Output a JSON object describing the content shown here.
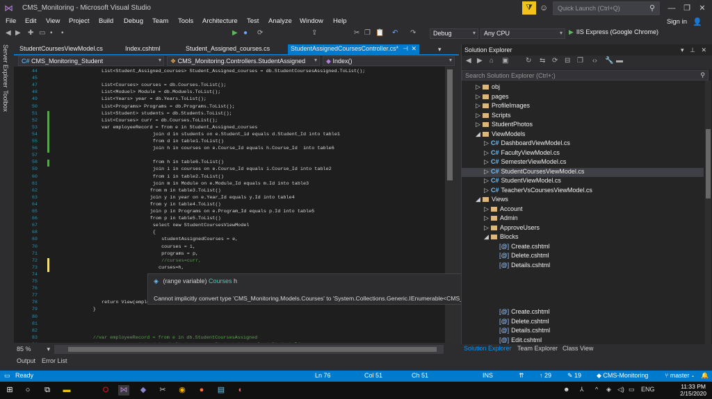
{
  "window": {
    "title": "CMS_Monitoring - Microsoft Visual Studio",
    "quick_launch_placeholder": "Quick Launch (Ctrl+Q)",
    "sign_in": "Sign in"
  },
  "menu": [
    "File",
    "Edit",
    "View",
    "Project",
    "Build",
    "Debug",
    "Team",
    "Tools",
    "Architecture",
    "Test",
    "Analyze",
    "Window",
    "Help"
  ],
  "toolbar": {
    "config": "Debug",
    "platform": "Any CPU",
    "run_target": "IIS Express (Google Chrome)"
  },
  "side_tools": [
    "Server Explorer",
    "Toolbox"
  ],
  "doc_tabs": [
    {
      "label": "StudentCoursesViewModel.cs"
    },
    {
      "label": "Index.cshtml"
    },
    {
      "label": "Student_Assigned_courses.cs"
    },
    {
      "label": "StudentAssignedCoursesController.cs*"
    }
  ],
  "nav": {
    "project": "CMS_Monitoring_Student",
    "class": "CMS_Monitoring.Controllers.StudentAssigned",
    "member": "Index()"
  },
  "code_lines": [
    {
      "n": "44",
      "t": "List<Student_Assigned_courses> Student_Assigned_courses = db.StudentCoursesAssigned.ToList();",
      "i": 0
    },
    {
      "n": "45",
      "t": "",
      "i": 0
    },
    {
      "n": "47",
      "t": "List<Courses> courses = db.Courses.ToList();",
      "i": 0
    },
    {
      "n": "48",
      "t": "List<Moduel> Module = db.Moduels.ToList();",
      "i": 0
    },
    {
      "n": "49",
      "t": "List<Years> year = db.Years.ToList();",
      "i": 0
    },
    {
      "n": "50",
      "t": "List<Programs> Programs = db.Programs.ToList();",
      "i": 0
    },
    {
      "n": "51",
      "t": "List<Student> students = db.Students.ToList();",
      "i": 0
    },
    {
      "n": "52",
      "t": "List<Courses> curr = db.Courses.ToList();",
      "i": 0
    },
    {
      "n": "53",
      "t": "var employeeRecord = from e in Student_Assigned_courses",
      "i": 0
    },
    {
      "n": "54",
      "t": "join d in students on e.Student_id equals d.Student_Id into table1",
      "i": 18
    },
    {
      "n": "55",
      "t": "from d in table1.ToList()",
      "i": 18
    },
    {
      "n": "56",
      "t": "join h in courses on e.Course_Id equals h.Course_Id  into table6",
      "i": 18
    },
    {
      "n": "57",
      "t": "",
      "i": 0
    },
    {
      "n": "58",
      "t": "from h in table6.ToList()",
      "i": 18
    },
    {
      "n": "59",
      "t": "join i in courses on e.Course_Id equals i.Course_Id into table2",
      "i": 18
    },
    {
      "n": "60",
      "t": "from i in table2.ToList()",
      "i": 18
    },
    {
      "n": "61",
      "t": "join m in Module on e.Module_Id equals m.Id into table3",
      "i": 18
    },
    {
      "n": "62",
      "t": "from m in table3.ToList()",
      "i": 17
    },
    {
      "n": "63",
      "t": "join y in year on e.Year_Id equals y.Id into table4",
      "i": 17
    },
    {
      "n": "64",
      "t": "from y in table4.ToList()",
      "i": 17
    },
    {
      "n": "65",
      "t": "join p in Programs on e.Program_Id equals p.Id into table5",
      "i": 17
    },
    {
      "n": "66",
      "t": "from p in table5.ToList()",
      "i": 17
    },
    {
      "n": "67",
      "t": "select new StudentCoursesViewModel",
      "i": 18
    },
    {
      "n": "68",
      "t": "{",
      "i": 18
    },
    {
      "n": "69",
      "t": "studentAssignedCourses = e,",
      "i": 21
    },
    {
      "n": "70",
      "t": "courses = i,",
      "i": 21
    },
    {
      "n": "71",
      "t": "programs = p,",
      "i": 21
    },
    {
      "n": "72",
      "t": "//curses=curr,",
      "i": 21
    },
    {
      "n": "73",
      "t": "curses=h,",
      "i": 20
    },
    {
      "n": "74",
      "t": "",
      "i": 0
    },
    {
      "n": "75",
      "t": "",
      "i": 0
    },
    {
      "n": "76",
      "t": "",
      "i": 0
    },
    {
      "n": "77",
      "t": "",
      "i": 0
    },
    {
      "n": "78",
      "t": "return View(employeeRecord);",
      "i": 0
    },
    {
      "n": "79",
      "t": "}",
      "i": -3
    },
    {
      "n": "80",
      "t": "",
      "i": 0
    },
    {
      "n": "81",
      "t": "",
      "i": 0
    },
    {
      "n": "82",
      "t": "",
      "i": 0
    },
    {
      "n": "83",
      "t": "//var employeeRecord = from e in db.StudentCoursesAssigned",
      "i": -3
    },
    {
      "n": "84",
      "t": "//              join d in db.Students on e.Student_id equals d.Student_Id",
      "i": -3
    }
  ],
  "tooltip": {
    "kind": "(range variable)",
    "var": "Courses",
    "name": "h",
    "message": "Cannot implicitly convert type 'CMS_Monitoring.Models.Courses' to 'System.Collections.Generic.IEnumerable<CMS_Monitoring.Models.Courses>'. An explicit conversion exists (are you missing a cast?)"
  },
  "zoom": "85 %",
  "solution_explorer": {
    "title": "Solution Explorer",
    "search_placeholder": "Search Solution Explorer (Ctrl+;)",
    "items": [
      {
        "label": "obj",
        "kind": "folder",
        "indent": 1,
        "exp": "▷"
      },
      {
        "label": "pages",
        "kind": "folder",
        "indent": 1,
        "exp": "▷"
      },
      {
        "label": "ProfileImages",
        "kind": "folder",
        "indent": 1,
        "exp": "▷"
      },
      {
        "label": "Scripts",
        "kind": "folder",
        "indent": 1,
        "exp": "▷"
      },
      {
        "label": "StudentPhotos",
        "kind": "folder",
        "indent": 1,
        "exp": "▷"
      },
      {
        "label": "ViewModels",
        "kind": "folder",
        "indent": 1,
        "exp": "◢"
      },
      {
        "label": "DashboardViewModel.cs",
        "kind": "cs",
        "indent": 2,
        "exp": "▷"
      },
      {
        "label": "FacultyViewModel.cs",
        "kind": "cs",
        "indent": 2,
        "exp": "▷"
      },
      {
        "label": "SemesterViewModel.cs",
        "kind": "cs",
        "indent": 2,
        "exp": "▷"
      },
      {
        "label": "StudentCoursesViewModel.cs",
        "kind": "cs",
        "indent": 2,
        "exp": "▷",
        "selected": true
      },
      {
        "label": "StudentViewModel.cs",
        "kind": "cs",
        "indent": 2,
        "exp": "▷"
      },
      {
        "label": "TeacherVsCoursesViewModel.cs",
        "kind": "cs",
        "indent": 2,
        "exp": "▷"
      },
      {
        "label": "Views",
        "kind": "folder",
        "indent": 1,
        "exp": "◢"
      },
      {
        "label": "Account",
        "kind": "folder",
        "indent": 2,
        "exp": "▷"
      },
      {
        "label": "Admin",
        "kind": "folder",
        "indent": 2,
        "exp": "▷"
      },
      {
        "label": "ApproveUsers",
        "kind": "folder",
        "indent": 2,
        "exp": "▷"
      },
      {
        "label": "Blocks",
        "kind": "folder",
        "indent": 2,
        "exp": "◢"
      },
      {
        "label": "Create.cshtml",
        "kind": "html",
        "indent": 3,
        "exp": ""
      },
      {
        "label": "Delete.cshtml",
        "kind": "html",
        "indent": 3,
        "exp": ""
      },
      {
        "label": "Details.cshtml",
        "kind": "html",
        "indent": 3,
        "exp": ""
      }
    ],
    "items_bottom": [
      {
        "label": "Create.cshtml",
        "kind": "html",
        "indent": 3
      },
      {
        "label": "Delete.cshtml",
        "kind": "html",
        "indent": 3
      },
      {
        "label": "Details.cshtml",
        "kind": "html",
        "indent": 3
      },
      {
        "label": "Edit.cshtml",
        "kind": "html",
        "indent": 3
      }
    ],
    "tabs": [
      "Solution Explorer",
      "Team Explorer",
      "Class View"
    ]
  },
  "bottom_tabs": [
    "Output",
    "Error List"
  ],
  "status": {
    "state": "Ready",
    "line": "Ln 76",
    "col": "Col 51",
    "ch": "Ch 51",
    "mode": "INS",
    "up": "29",
    "pencil": "19",
    "repo": "CMS-Monitoring",
    "branch": "master"
  },
  "taskbar": {
    "lang": "ENG",
    "time": "11:33 PM",
    "date": "2/15/2020"
  },
  "colors": {
    "accent": "#007acc",
    "editor_bg": "#1e1e1e",
    "keyword": "#569cd6",
    "type": "#4ec9b0",
    "comment": "#57a64a"
  }
}
